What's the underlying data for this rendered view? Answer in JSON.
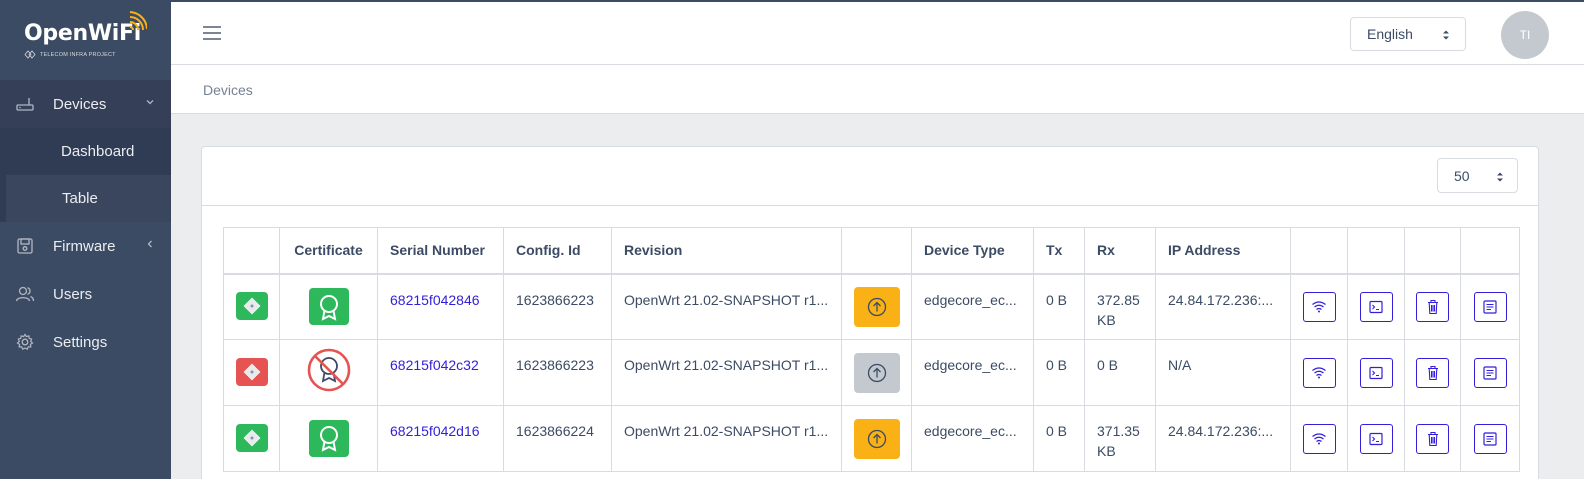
{
  "brand": {
    "name": "OpenWiFi",
    "sub": "TELECOM INFRA PROJECT"
  },
  "sidebar": {
    "items": [
      {
        "label": "Devices"
      },
      {
        "label": "Dashboard"
      },
      {
        "label": "Table"
      },
      {
        "label": "Firmware"
      },
      {
        "label": "Users"
      },
      {
        "label": "Settings"
      }
    ]
  },
  "header": {
    "language": "English",
    "avatar": "TI"
  },
  "breadcrumb": "Devices",
  "card": {
    "page_size": "50"
  },
  "table": {
    "headers": [
      "",
      "Certificate",
      "Serial Number",
      "Config. Id",
      "Revision",
      "",
      "Device Type",
      "Tx",
      "Rx",
      "IP Address",
      "",
      "",
      "",
      ""
    ],
    "rows": [
      {
        "status": "connected",
        "cert": "valid",
        "serial": "68215f042846",
        "config_id": "1623866223",
        "revision": "OpenWrt 21.02-SNAPSHOT r1...",
        "upgrade": "available",
        "device_type": "edgecore_ec...",
        "tx": "0 B",
        "rx": "372.85 KB",
        "ip": "24.84.172.236:..."
      },
      {
        "status": "disconnected",
        "cert": "none",
        "serial": "68215f042c32",
        "config_id": "1623866223",
        "revision": "OpenWrt 21.02-SNAPSHOT r1...",
        "upgrade": "disabled",
        "device_type": "edgecore_ec...",
        "tx": "0 B",
        "rx": "0 B",
        "ip": "N/A"
      },
      {
        "status": "connected",
        "cert": "valid",
        "serial": "68215f042d16",
        "config_id": "1623866224",
        "revision": "OpenWrt 21.02-SNAPSHOT r1...",
        "upgrade": "available",
        "device_type": "edgecore_ec...",
        "tx": "0 B",
        "rx": "371.35 KB",
        "ip": "24.84.172.236:..."
      }
    ]
  },
  "colors": {
    "sidebar": "#3c4b64",
    "primary": "#321fdb",
    "success": "#2eb85c",
    "danger": "#e55353",
    "warning": "#f9b115"
  }
}
